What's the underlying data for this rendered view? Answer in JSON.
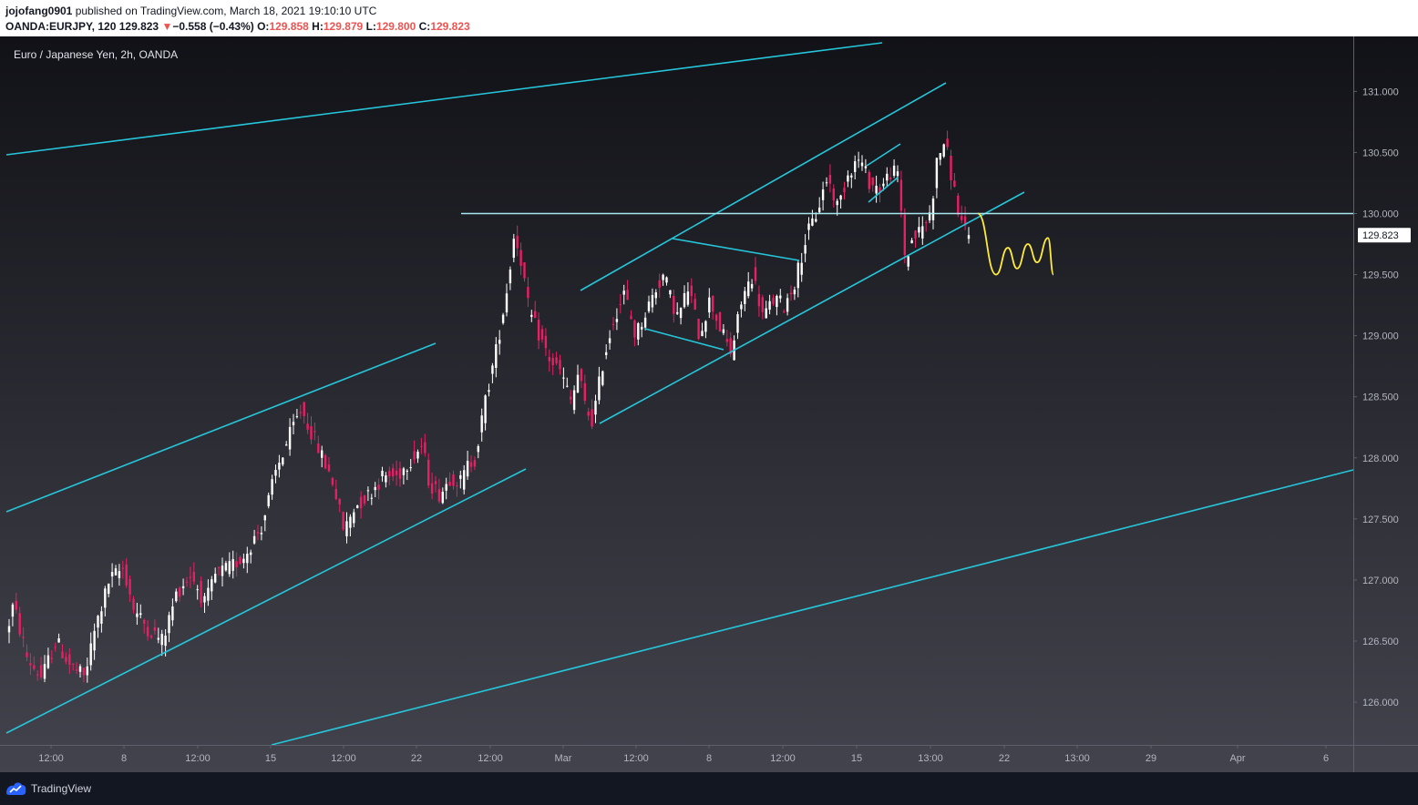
{
  "header": {
    "username": "jojofang0901",
    "published_text": "published on TradingView.com, March 18, 2021 19:10:10 UTC",
    "symbol": "OANDA:EURJPY, 120",
    "last_price": "129.823",
    "change_arrow": "▼",
    "change_text": "−0.558 (−0.43%)",
    "open_label": "O:",
    "open_value": "129.858",
    "high_label": "H:",
    "high_value": "129.879",
    "low_label": "L:",
    "low_value": "129.800",
    "close_label": "C:",
    "close_value": "129.823"
  },
  "footer": {
    "brand": "TradingView"
  },
  "colors": {
    "up": "#ffffff",
    "down": "#e91e63",
    "trendline": "#26c6da",
    "hline": "#a8e6f0",
    "forecast": "#ffeb3b",
    "axis_text": "#b2b5be",
    "price_tag_bg": "#ffffff",
    "price_tag_text": "#131722"
  },
  "chart_data": {
    "type": "candlestick",
    "title": "Euro / Japanese Yen, 2h, OANDA",
    "ylim": [
      125.65,
      131.45
    ],
    "y_ticks": [
      126.0,
      126.5,
      127.0,
      127.5,
      128.0,
      128.5,
      129.0,
      129.5,
      130.0,
      130.5,
      131.0
    ],
    "y_tick_labels": [
      "126.000",
      "126.500",
      "127.000",
      "127.500",
      "128.000",
      "128.500",
      "129.000",
      "129.500",
      "130.000",
      "130.500",
      "131.000"
    ],
    "x_tick_labels": [
      "12:00",
      "8",
      "12:00",
      "15",
      "12:00",
      "22",
      "12:00",
      "Mar",
      "12:00",
      "8",
      "12:00",
      "15",
      "13:00",
      "22",
      "13:00",
      "29",
      "Apr",
      "6"
    ],
    "last_price": 129.823,
    "last_price_label": "129.823",
    "horizontal_level": 130.0,
    "path_anchors": [
      [
        0,
        126.55
      ],
      [
        2,
        126.8
      ],
      [
        6,
        126.35
      ],
      [
        10,
        126.2
      ],
      [
        14,
        126.5
      ],
      [
        18,
        126.3
      ],
      [
        22,
        126.2
      ],
      [
        25,
        126.6
      ],
      [
        29,
        127.0
      ],
      [
        33,
        127.1
      ],
      [
        36,
        126.75
      ],
      [
        40,
        126.6
      ],
      [
        44,
        126.5
      ],
      [
        48,
        126.9
      ],
      [
        52,
        127.05
      ],
      [
        56,
        126.8
      ],
      [
        59,
        127.05
      ],
      [
        63,
        127.1
      ],
      [
        67,
        127.2
      ],
      [
        72,
        127.45
      ],
      [
        76,
        127.9
      ],
      [
        80,
        128.2
      ],
      [
        83,
        128.4
      ],
      [
        86,
        128.2
      ],
      [
        89,
        128.0
      ],
      [
        92,
        127.8
      ],
      [
        95,
        127.4
      ],
      [
        98,
        127.6
      ],
      [
        102,
        127.7
      ],
      [
        106,
        127.85
      ],
      [
        110,
        127.85
      ],
      [
        114,
        128.0
      ],
      [
        117,
        128.1
      ],
      [
        119,
        127.8
      ],
      [
        122,
        127.7
      ],
      [
        125,
        127.85
      ],
      [
        128,
        127.8
      ],
      [
        130,
        127.95
      ],
      [
        132,
        128.0
      ],
      [
        135,
        128.5
      ],
      [
        138,
        128.9
      ],
      [
        141,
        129.4
      ],
      [
        143,
        129.85
      ],
      [
        145,
        129.6
      ],
      [
        147,
        129.2
      ],
      [
        150,
        129.0
      ],
      [
        153,
        128.8
      ],
      [
        156,
        128.7
      ],
      [
        159,
        128.45
      ],
      [
        161,
        128.7
      ],
      [
        163,
        128.4
      ],
      [
        165,
        128.3
      ],
      [
        168,
        128.8
      ],
      [
        171,
        129.15
      ],
      [
        174,
        129.35
      ],
      [
        177,
        129.0
      ],
      [
        180,
        129.2
      ],
      [
        183,
        129.4
      ],
      [
        185,
        129.5
      ],
      [
        187,
        129.3
      ],
      [
        189,
        129.15
      ],
      [
        192,
        129.4
      ],
      [
        195,
        129.0
      ],
      [
        198,
        129.3
      ],
      [
        201,
        129.05
      ],
      [
        204,
        128.85
      ],
      [
        207,
        129.3
      ],
      [
        210,
        129.5
      ],
      [
        213,
        129.15
      ],
      [
        216,
        129.3
      ],
      [
        219,
        129.25
      ],
      [
        222,
        129.45
      ],
      [
        225,
        129.8
      ],
      [
        228,
        130.0
      ],
      [
        231,
        130.3
      ],
      [
        234,
        130.05
      ],
      [
        237,
        130.35
      ],
      [
        240,
        130.45
      ],
      [
        243,
        130.25
      ],
      [
        246,
        130.2
      ],
      [
        249,
        130.35
      ],
      [
        251,
        130.3
      ],
      [
        253,
        129.6
      ],
      [
        255,
        129.8
      ],
      [
        257,
        129.85
      ],
      [
        260,
        130.0
      ],
      [
        262,
        130.45
      ],
      [
        264,
        130.6
      ],
      [
        266,
        130.3
      ],
      [
        268,
        130.0
      ],
      [
        270,
        129.823
      ]
    ],
    "forecast_path": [
      [
        1073,
        130.0
      ],
      [
        1093,
        129.5
      ],
      [
        1106,
        129.72
      ],
      [
        1116,
        129.55
      ],
      [
        1128,
        129.75
      ],
      [
        1138,
        129.6
      ],
      [
        1150,
        129.8
      ],
      [
        1156,
        129.5
      ]
    ]
  }
}
